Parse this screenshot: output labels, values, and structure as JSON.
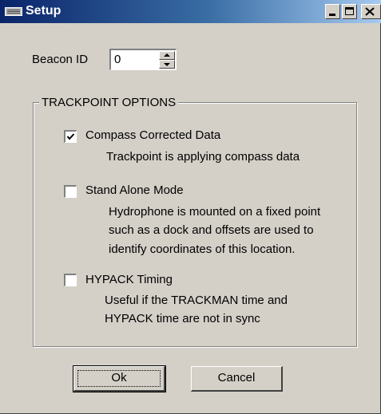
{
  "window": {
    "title": "Setup",
    "title_icon": "keyboard-icon",
    "controls": [
      "minimize-icon",
      "maximize-icon",
      "close-icon"
    ]
  },
  "beacon": {
    "label": "Beacon ID",
    "value": "0"
  },
  "trackpoint": {
    "legend": "TRACKPOINT OPTIONS",
    "options": [
      {
        "label": "Compass Corrected Data",
        "checked": true,
        "description": [
          "Trackpoint is applying compass data"
        ]
      },
      {
        "label": "Stand Alone Mode",
        "checked": false,
        "description": [
          "Hydrophone is mounted on a fixed point",
          "such as a dock and offsets are used to",
          "identify coordinates of this location."
        ]
      },
      {
        "label": "HYPACK Timing",
        "checked": false,
        "description": [
          "Useful if the TRACKMAN time and",
          "HYPACK time are not in sync"
        ]
      }
    ]
  },
  "buttons": {
    "ok": "Ok",
    "cancel": "Cancel"
  },
  "colors": {
    "face": "#d4d0c8",
    "title_start": "#0a246a",
    "title_end": "#a6caf0"
  }
}
